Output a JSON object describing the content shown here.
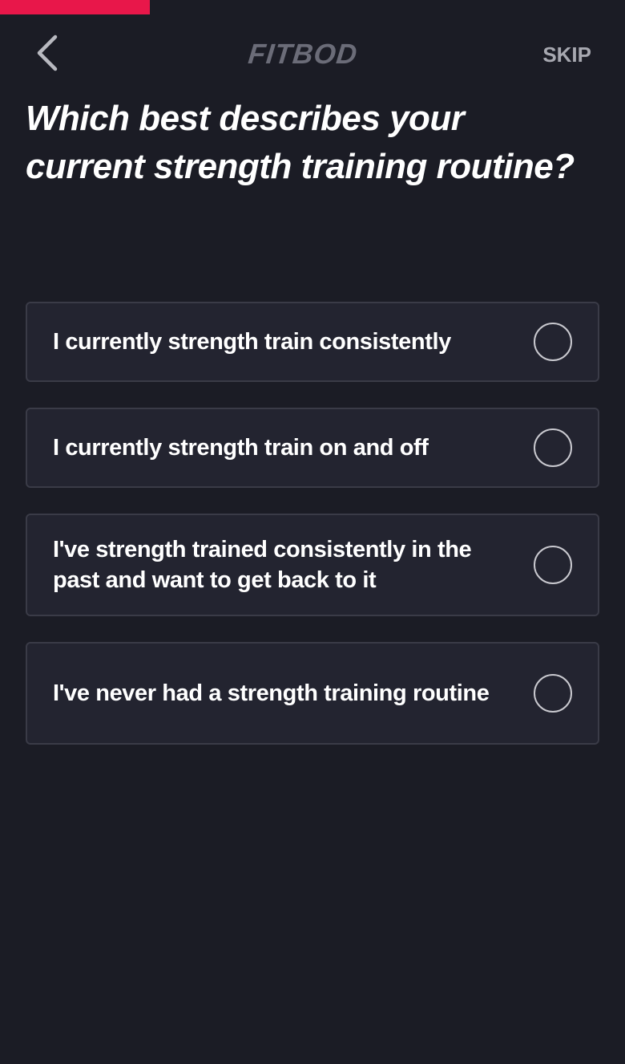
{
  "progress": {
    "fraction": 0.24,
    "color": "#e8174a"
  },
  "header": {
    "back_icon": "chevron-left-icon",
    "logo_text": "FITBOD",
    "skip_label": "SKIP"
  },
  "question": {
    "title": "Which best describes your current strength training routine?"
  },
  "options": [
    {
      "label": "I currently strength train consistently",
      "selected": false
    },
    {
      "label": "I currently strength train on and off",
      "selected": false
    },
    {
      "label": "I've strength trained consistently in the past and want to get back to it",
      "selected": false
    },
    {
      "label": "I've never had a strength training routine",
      "selected": false
    }
  ],
  "colors": {
    "background": "#1b1c25",
    "card": "#232430",
    "card_border": "#3a3b47",
    "accent": "#e8174a",
    "logo": "#6b6c78",
    "skip": "#a7a8b0"
  }
}
